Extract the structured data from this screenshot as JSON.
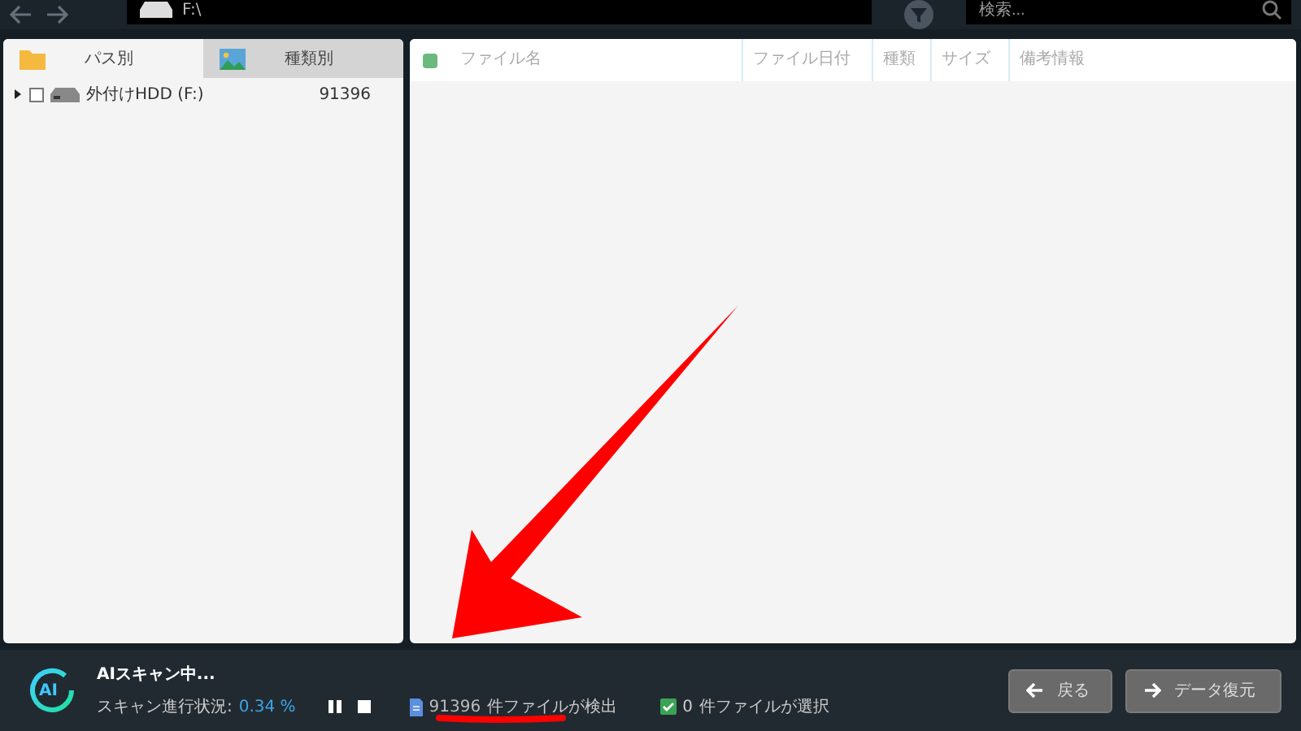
{
  "toolbar": {
    "path": "F:\\",
    "search_placeholder": "検索..."
  },
  "left_panel": {
    "tabs": [
      {
        "label": "パス別",
        "kind": "folder",
        "selected": true
      },
      {
        "label": "種類別",
        "kind": "image",
        "selected": false
      }
    ],
    "tree": [
      {
        "label": "外付けHDD (F:)",
        "count": "91396",
        "checked": false,
        "expanded": false
      }
    ]
  },
  "file_list": {
    "select_all_checked": true,
    "columns": [
      "ファイル名",
      "ファイル日付",
      "種類",
      "サイズ",
      "備考情報"
    ]
  },
  "status_bar": {
    "logo_text": "AI",
    "title": "AIスキャン中...",
    "progress_label": "スキャン進行状況:",
    "progress_value": "0.34 %",
    "found_count": "91396",
    "found_label": "件ファイルが検出",
    "selected_checked": true,
    "selected_count": "0",
    "selected_label": "件ファイルが選択",
    "buttons": [
      {
        "label": "戻る",
        "kind": "back"
      },
      {
        "label": "データ復元",
        "kind": "restore"
      }
    ]
  }
}
